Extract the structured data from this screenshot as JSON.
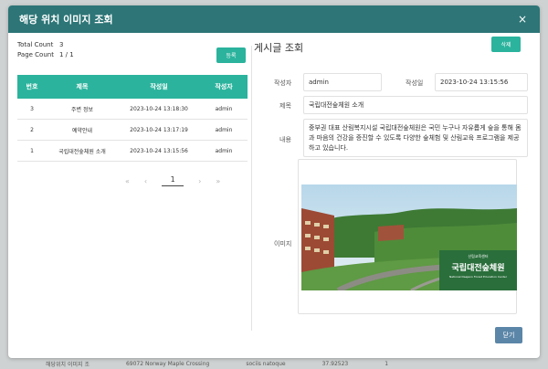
{
  "modal": {
    "title": "해당 위치 이미지 조회",
    "close_glyph": "×"
  },
  "left": {
    "total_count_label": "Total Count",
    "total_count_value": "3",
    "page_count_label": "Page Count",
    "page_count_value": "1 / 1",
    "register_label": "등록",
    "columns": [
      "번호",
      "제목",
      "작성일",
      "작성자"
    ],
    "rows": [
      {
        "no": "3",
        "title": "주변 정보",
        "date": "2023-10-24 13:18:30",
        "author": "admin"
      },
      {
        "no": "2",
        "title": "예약안내",
        "date": "2023-10-24 13:17:19",
        "author": "admin"
      },
      {
        "no": "1",
        "title": "국립대전숲체원 소개",
        "date": "2023-10-24 13:15:56",
        "author": "admin"
      }
    ],
    "pager": {
      "first": "«",
      "prev": "‹",
      "current": "1",
      "next": "›",
      "last": "»"
    }
  },
  "right": {
    "title": "게시글 조회",
    "delete_label": "삭제",
    "author_label": "작성자",
    "author_value": "admin",
    "date_label": "작성일",
    "date_value": "2023-10-24 13:15:56",
    "subject_label": "제목",
    "subject_value": "국립대전숲체원 소개",
    "content_label": "내용",
    "content_value": "중부권 대표 산림복지시설 국립대전숲체원은 국민 누구나 자유롭게 숲을 통해 몸과 마음의 건강을 증진할 수 있도록 다양한 숲체험 및 산림교육 프로그램을 제공하고 있습니다.",
    "image_label": "이미지",
    "photo": {
      "caption_small": "산림교육센터",
      "caption_big": "국립대전숲체원",
      "caption_en": "National Daejeon Forest Education Center"
    },
    "close_label": "닫기"
  },
  "backdrop": {
    "row": [
      "해당위치 이미지 조",
      "69072 Norway Maple Crossing",
      "sociis natoque",
      "37.92523",
      "1"
    ]
  },
  "colors": {
    "header": "#2d7577",
    "accent": "#2bb39d",
    "close_button": "#5b86a8"
  }
}
